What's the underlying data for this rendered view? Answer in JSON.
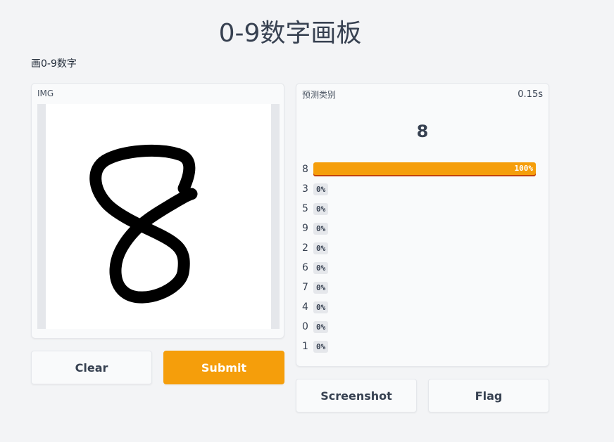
{
  "title": "0-9数字画板",
  "description": "画0-9数字",
  "image_panel": {
    "label": "IMG",
    "drawn_digit_icon": "handwritten-eight"
  },
  "prediction_panel": {
    "label": "预测类别",
    "time": "0.15s",
    "top_prediction": "8",
    "rows": [
      {
        "label": "8",
        "pct": "100%",
        "value": 1.0
      },
      {
        "label": "3",
        "pct": "0%",
        "value": 0
      },
      {
        "label": "5",
        "pct": "0%",
        "value": 0
      },
      {
        "label": "9",
        "pct": "0%",
        "value": 0
      },
      {
        "label": "2",
        "pct": "0%",
        "value": 0
      },
      {
        "label": "6",
        "pct": "0%",
        "value": 0
      },
      {
        "label": "7",
        "pct": "0%",
        "value": 0
      },
      {
        "label": "4",
        "pct": "0%",
        "value": 0
      },
      {
        "label": "0",
        "pct": "0%",
        "value": 0
      },
      {
        "label": "1",
        "pct": "0%",
        "value": 0
      }
    ]
  },
  "buttons": {
    "clear": "Clear",
    "submit": "Submit",
    "screenshot": "Screenshot",
    "flag": "Flag"
  },
  "colors": {
    "accent": "#f59e0b",
    "background": "#f3f4f6"
  }
}
